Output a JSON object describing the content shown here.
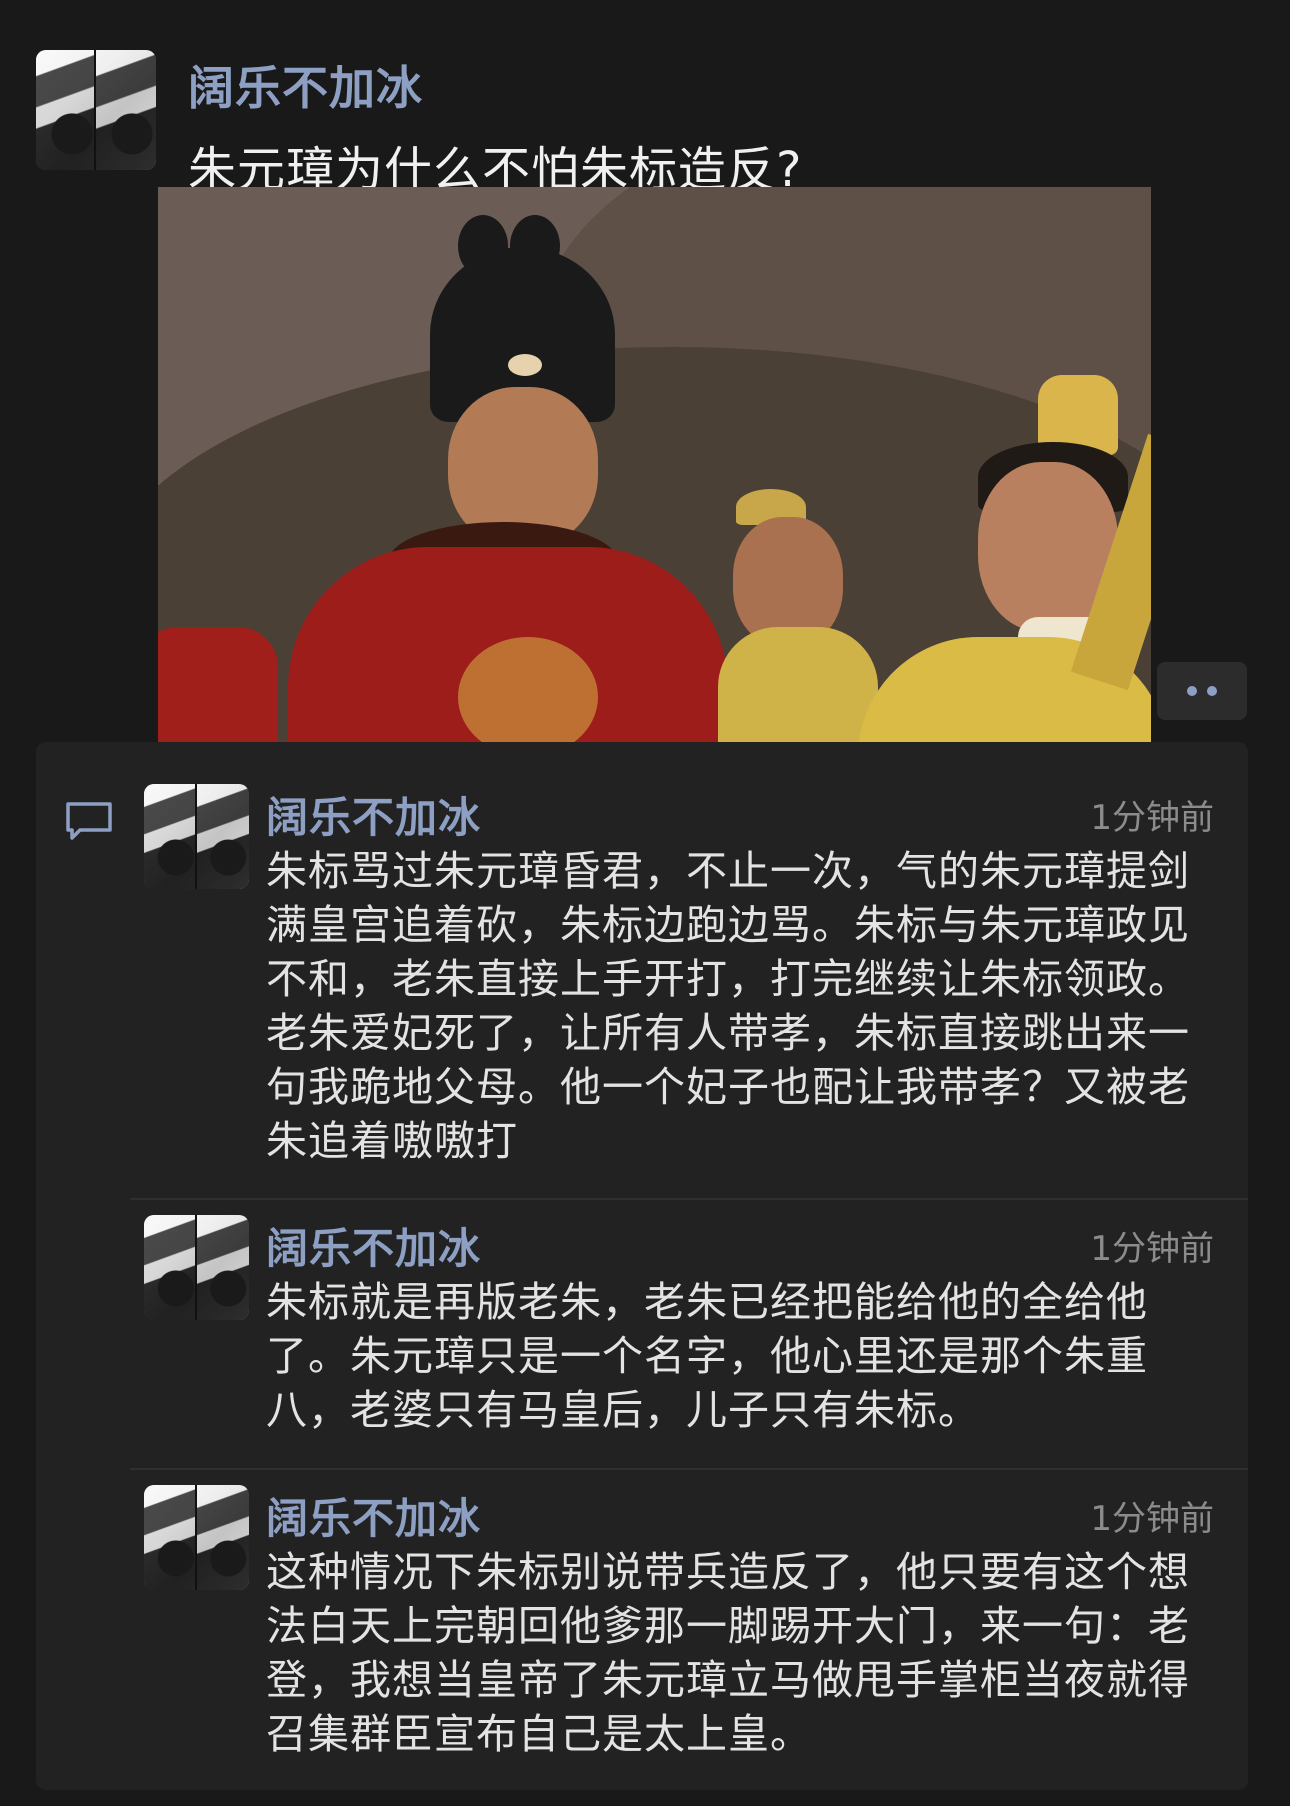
{
  "post": {
    "author": "阔乐不加冰",
    "title": "朱元璋为什么不怕朱标造反?"
  },
  "comments": [
    {
      "author": "阔乐不加冰",
      "time": "1分钟前",
      "text": "朱标骂过朱元璋昏君，不止一次，气的朱元璋提剑满皇宫追着砍，朱标边跑边骂。朱标与朱元璋政见不和，老朱直接上手开打，打完继续让朱标领政。老朱爱妃死了，让所有人带孝，朱标直接跳出来一句我跪地父母。他一个妃子也配让我带孝？又被老朱追着嗷嗷打"
    },
    {
      "author": "阔乐不加冰",
      "time": "1分钟前",
      "text": "朱标就是再版老朱，老朱已经把能给他的全给他了。朱元璋只是一个名字，他心里还是那个朱重八，老婆只有马皇后，儿子只有朱标。"
    },
    {
      "author": "阔乐不加冰",
      "time": "1分钟前",
      "text": "这种情况下朱标别说带兵造反了，他只要有这个想法白天上完朝回他爹那一脚踢开大门，来一句：老登，我想当皇帝了朱元璋立马做甩手掌柜当夜就得召集群臣宣布自己是太上皇。"
    }
  ],
  "icons": {
    "comment": "comment-bubble-icon",
    "more": "more-dots-icon"
  },
  "colors": {
    "background": "#191919",
    "panel": "#222222",
    "author": "#8da0c3",
    "text": "#e3e3e3",
    "time": "#8c8c8c"
  }
}
